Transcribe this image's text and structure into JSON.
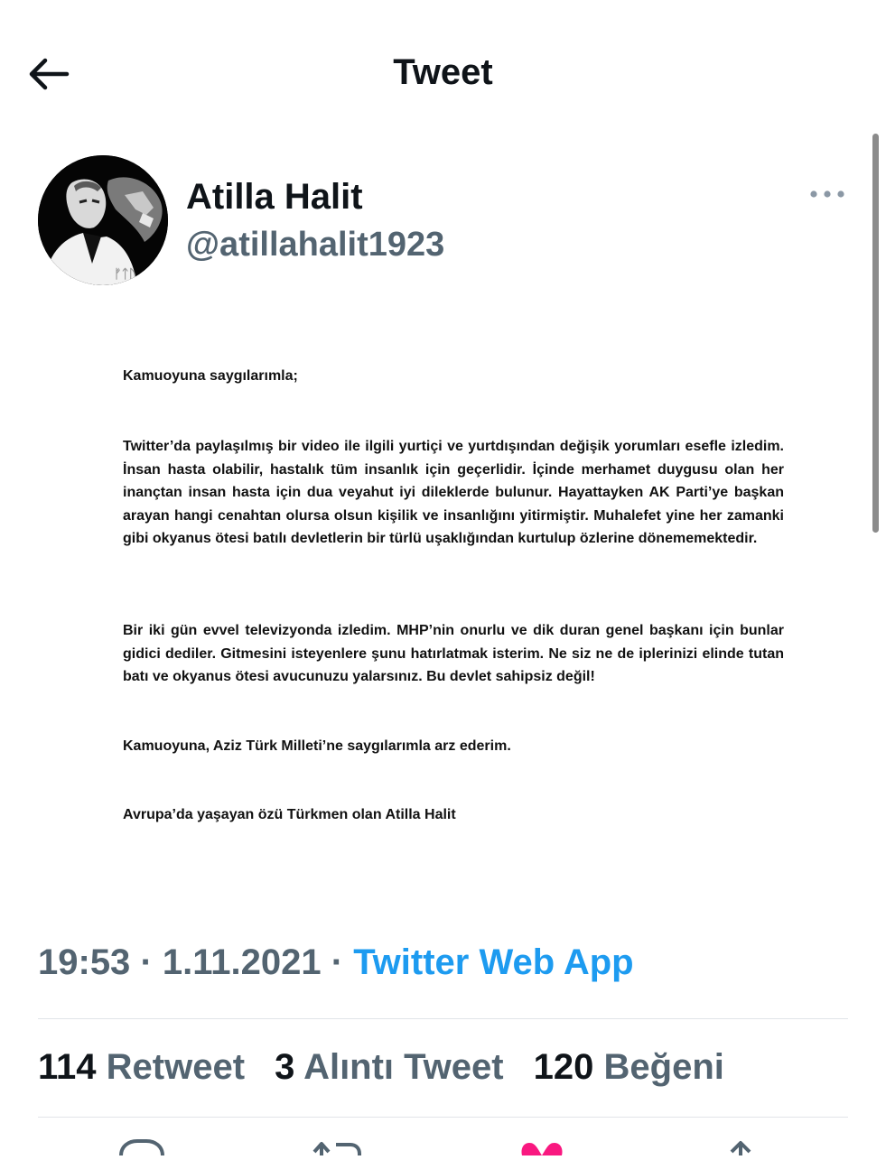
{
  "header": {
    "title": "Tweet",
    "back_icon": "arrow-left-icon"
  },
  "tweet": {
    "author": {
      "name": "Atilla Halit",
      "handle": "@atillahalit1923"
    },
    "more_icon": "more-horizontal-icon",
    "image_text": {
      "salutation": "Kamuoyuna saygılarımla;",
      "para1": "Twitter’da paylaşılmış bir video ile ilgili yurtiçi ve yurtdışından değişik yorumları esefle izledim. İnsan hasta olabilir, hastalık tüm insanlık için geçerlidir. İçinde merhamet duygusu olan her inançtan insan hasta için dua veyahut iyi dileklerde bulunur. Hayattayken AK Parti’ye başkan arayan hangi cenahtan olursa olsun kişilik ve insanlığını yitirmiştir. Muhalefet yine her zamanki gibi okyanus ötesi batılı devletlerin bir türlü uşaklığından kurtulup özlerine dönememektedir.",
      "para2": "Bir iki gün evvel televizyonda izledim. MHP’nin onurlu ve dik duran genel başkanı için bunlar gidici dediler. Gitmesini isteyenlere şunu hatırlatmak isterim. Ne siz ne de iplerinizi elinde tutan batı ve okyanus ötesi avucunuzu yalarsınız. Bu devlet sahipsiz değil!",
      "closing": "Kamuoyuna, Aziz Türk Milleti’ne saygılarımla arz ederim.",
      "signature": "Avrupa’da yaşayan özü Türkmen olan Atilla Halit"
    },
    "time": "19:53",
    "separator": "·",
    "date": "1.11.2021",
    "source": "Twitter Web App",
    "stats": {
      "retweets": {
        "count": "114",
        "label": "Retweet"
      },
      "quotes": {
        "count": "3",
        "label": "Alıntı Tweet"
      },
      "likes": {
        "count": "120",
        "label": "Beğeni"
      }
    },
    "actions": [
      "reply-icon",
      "retweet-icon",
      "like-icon",
      "share-icon"
    ],
    "colors": {
      "link": "#1d9bf0",
      "secondary": "#536471",
      "like": "#f91880"
    }
  }
}
